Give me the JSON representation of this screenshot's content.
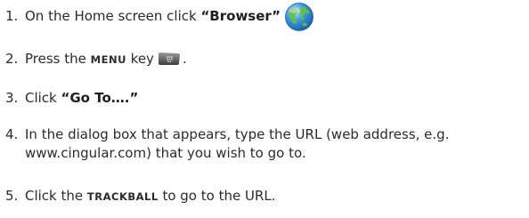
{
  "steps": [
    {
      "number": "1.",
      "text_before": "On the Home screen click ",
      "highlight": "“Browser”",
      "icon": "browser-globe-icon"
    },
    {
      "number": "2.",
      "text_before": "Press the ",
      "key": "MENU",
      "text_after": " key",
      "icon": "menu-key-icon",
      "trailing": "."
    },
    {
      "number": "3.",
      "text_before": "Click ",
      "highlight": "“Go To….”"
    },
    {
      "number": "4.",
      "line1": "In the dialog box that appears, type the URL (web address, e.g.",
      "line2": "www.cingular.com) that you wish to go to."
    },
    {
      "number": "5.",
      "text_before": "Click the ",
      "key": "TRACKBALL",
      "text_after": " to go to the URL."
    }
  ],
  "colors": {
    "text": "#2b2b2b",
    "globe_blue": "#2f8fd6",
    "globe_green": "#6bbf3a"
  }
}
